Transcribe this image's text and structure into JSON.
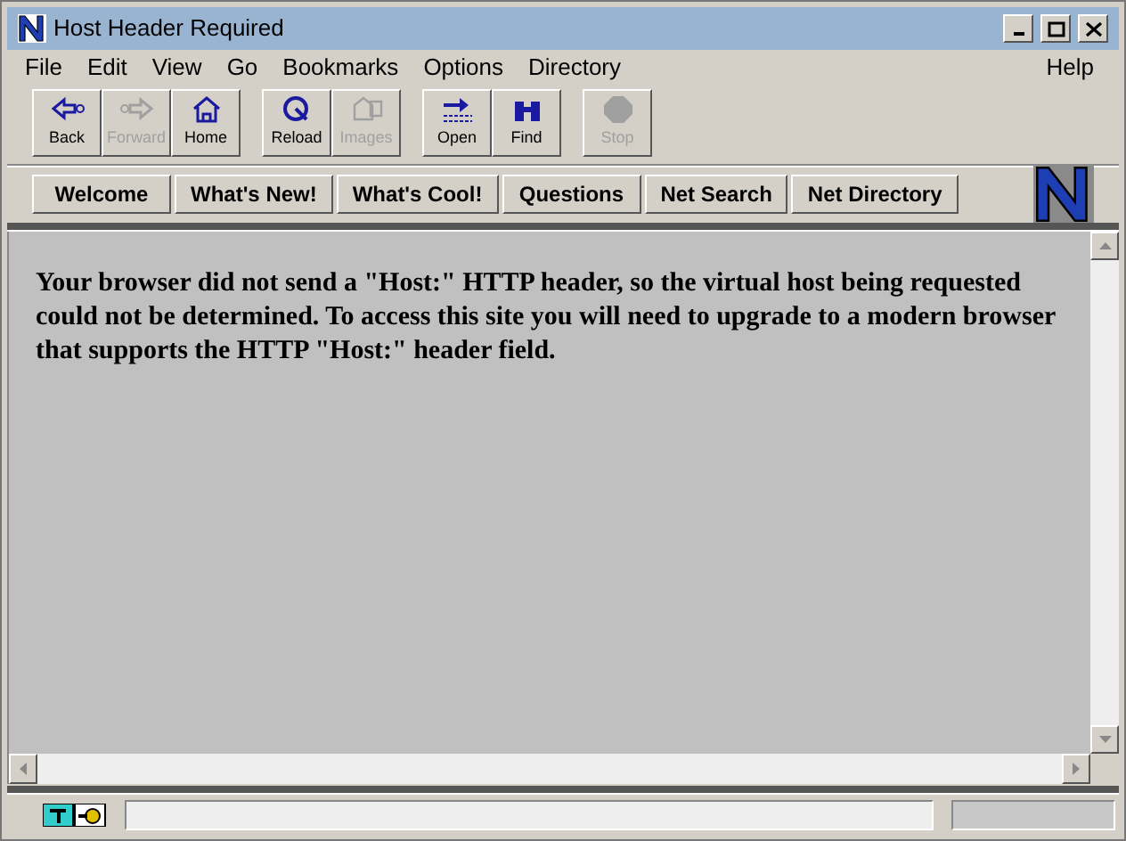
{
  "window": {
    "title": "Host Header Required"
  },
  "menu": [
    "File",
    "Edit",
    "View",
    "Go",
    "Bookmarks",
    "Options",
    "Directory"
  ],
  "help_menu": "Help",
  "toolbar": [
    [
      {
        "label": "Back",
        "disabled": false
      },
      {
        "label": "Forward",
        "disabled": true
      },
      {
        "label": "Home",
        "disabled": false
      }
    ],
    [
      {
        "label": "Reload",
        "disabled": false
      },
      {
        "label": "Images",
        "disabled": true
      }
    ],
    [
      {
        "label": "Open",
        "disabled": false
      },
      {
        "label": "Find",
        "disabled": false
      }
    ],
    [
      {
        "label": "Stop",
        "disabled": true
      }
    ]
  ],
  "directory_buttons": [
    "Welcome",
    "What's New!",
    "What's Cool!",
    "Questions",
    "Net Search",
    "Net Directory"
  ],
  "content": {
    "message": "Your browser did not send a \"Host:\" HTTP header, so the virtual host being requested could not be determined. To access this site you will need to upgrade to a modern browser that supports the HTTP \"Host:\" header field."
  }
}
